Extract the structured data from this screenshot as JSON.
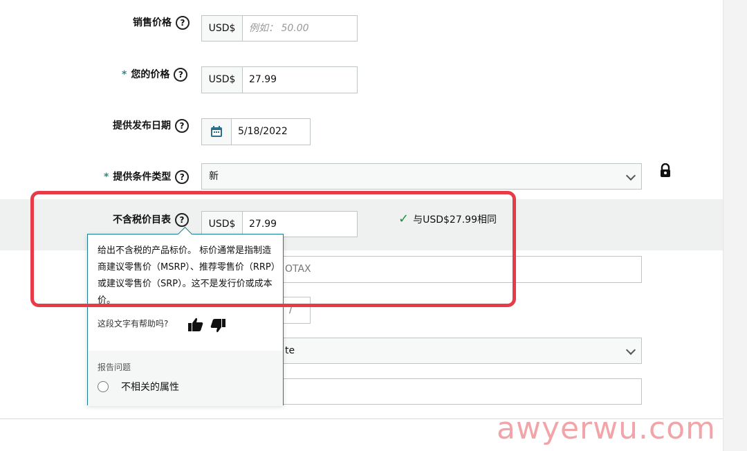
{
  "fields": {
    "sale_price": {
      "label": "销售价格",
      "currency": "USD$",
      "placeholder": "例如： 50.00"
    },
    "your_price": {
      "required_mark": "*",
      "label": "您的价格",
      "currency": "USD$",
      "value": "27.99"
    },
    "offer_release_date": {
      "label": "提供发布日期",
      "value": "5/18/2022"
    },
    "condition_type": {
      "required_mark": "*",
      "label": "提供条件类型",
      "value": "新"
    },
    "list_price_ex_tax": {
      "label": "不含税价目表",
      "currency": "USD$",
      "value": "27.99",
      "status": "与USD$27.99相同"
    },
    "partial_a": {
      "value": "OTAX"
    },
    "partial_b": {
      "value": "/"
    },
    "partial_c": {
      "value": "te"
    }
  },
  "help_symbol": "?",
  "tooltip": {
    "text": "给出不含税的产品标价。 标价通常是指制造商建议零售价（MSRP）、推荐零售价（RRP）或建议零售价（SRP）。这不是发行价或成本价。",
    "feedback_question": "这段文字有帮助吗?",
    "report_title": "报告问题",
    "report_option": "不相关的属性"
  },
  "watermark": "awyerwu.com",
  "icons": {
    "lock": "lock-icon",
    "calendar": "calendar-icon",
    "thumbs_up": "thumbs-up-icon",
    "thumbs_down": "thumbs-down-icon",
    "check": "check-icon"
  },
  "colors": {
    "highlight": "#e73c47",
    "accent": "#1a7f93",
    "success": "#1a8f3a"
  }
}
